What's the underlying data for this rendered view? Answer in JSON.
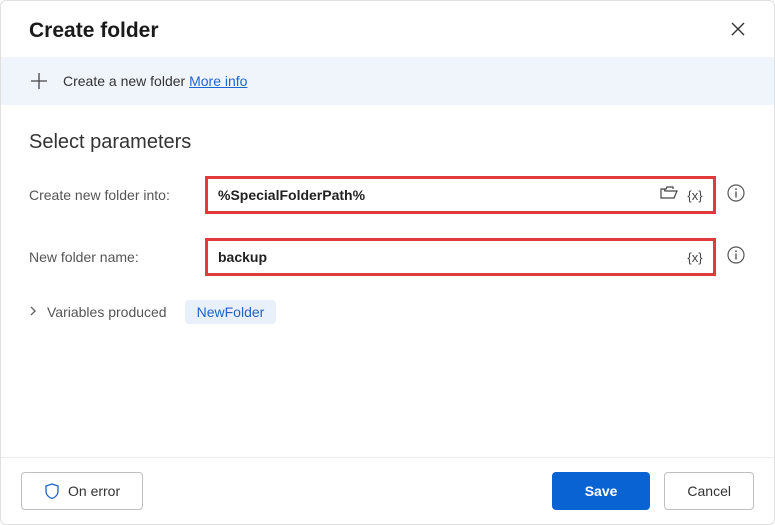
{
  "header": {
    "title": "Create folder"
  },
  "banner": {
    "text": "Create a new folder ",
    "link": "More info"
  },
  "section": {
    "title": "Select parameters"
  },
  "fields": {
    "into": {
      "label": "Create new folder into:",
      "value": "%SpecialFolderPath%"
    },
    "name": {
      "label": "New folder name:",
      "value": "backup"
    }
  },
  "vars": {
    "label": "Variables produced",
    "pill": "NewFolder"
  },
  "footer": {
    "error": "On error",
    "save": "Save",
    "cancel": "Cancel"
  }
}
